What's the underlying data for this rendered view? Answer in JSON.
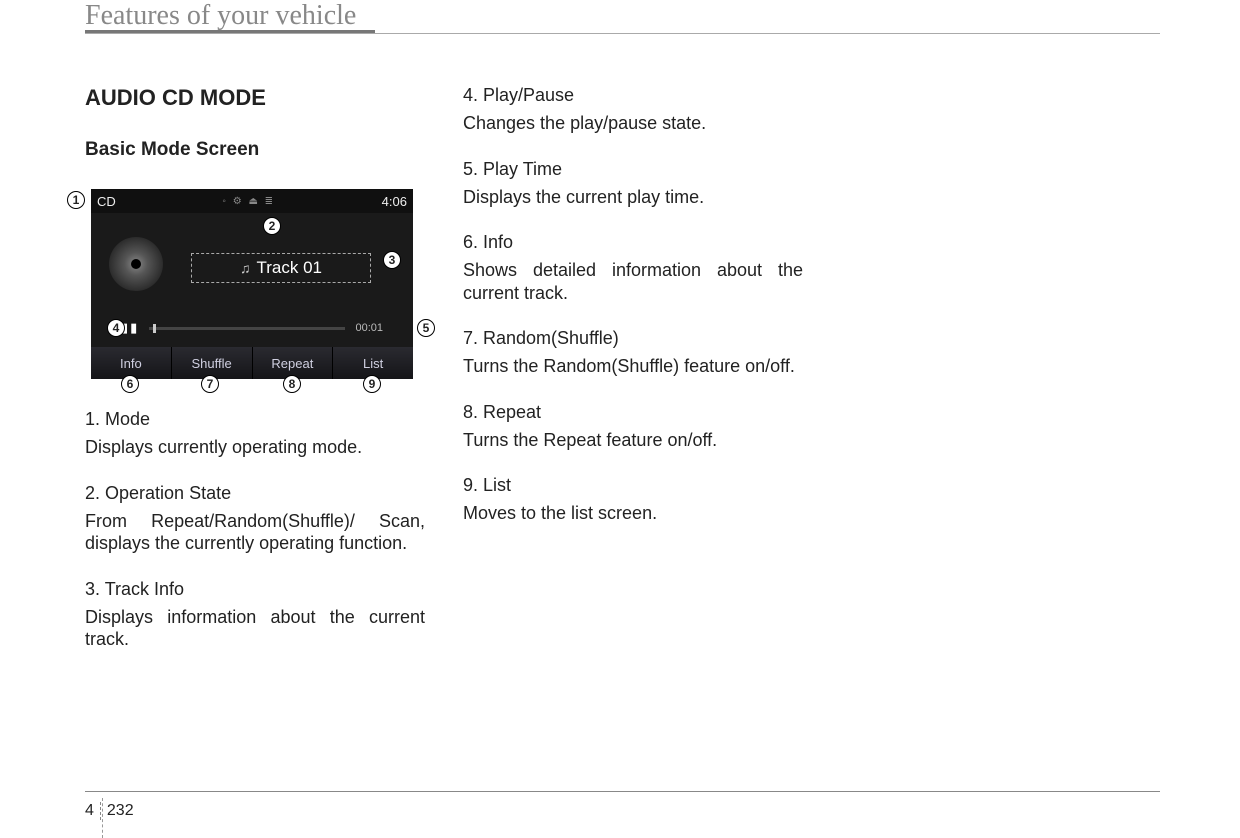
{
  "header": {
    "title": "Features of your vehicle"
  },
  "section": {
    "title": "AUDIO CD MODE",
    "subtitle": "Basic Mode Screen"
  },
  "screenshot": {
    "mode_label": "CD",
    "clock": "4:06",
    "track_label": "Track 01",
    "elapsed": "00:01",
    "buttons": {
      "info": "Info",
      "shuffle": "Shuffle",
      "repeat": "Repeat",
      "list": "List"
    }
  },
  "callouts": {
    "1": "1",
    "2": "2",
    "3": "3",
    "4": "4",
    "5": "5",
    "6": "6",
    "7": "7",
    "8": "8",
    "9": "9"
  },
  "items_left": [
    {
      "head": "1. Mode",
      "body": "Displays currently operating mode."
    },
    {
      "head": "2. Operation State",
      "body": "From Repeat/Random(Shuffle)/ Scan, displays the currently operating function."
    },
    {
      "head": "3. Track Info",
      "body": "Displays information about the current track."
    }
  ],
  "items_right": [
    {
      "head": "4. Play/Pause",
      "body": "Changes the play/pause state."
    },
    {
      "head": "5. Play Time",
      "body": "Displays the current play time."
    },
    {
      "head": "6. Info",
      "body": "Shows detailed information about the current track."
    },
    {
      "head": "7. Random(Shuffle)",
      "body": "Turns the Random(Shuffle) feature on/off."
    },
    {
      "head": "8. Repeat",
      "body": "Turns the Repeat feature on/off."
    },
    {
      "head": "9. List",
      "body": "Moves to the list screen."
    }
  ],
  "footer": {
    "chapter": "4",
    "page": "232"
  }
}
